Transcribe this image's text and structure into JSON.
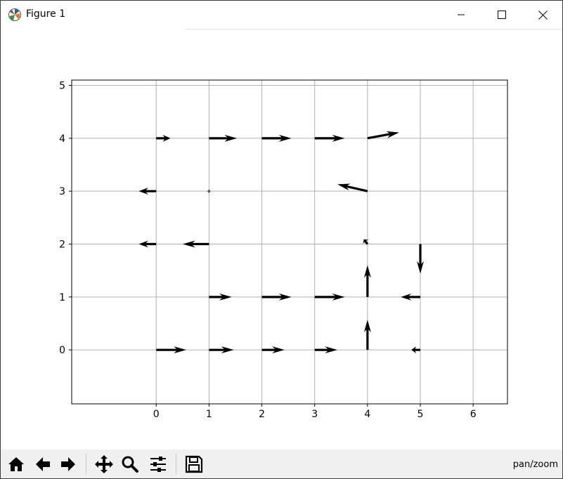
{
  "window": {
    "title": "Figure 1"
  },
  "icons": {
    "app": "matplotlib-logo-icon",
    "minimize": "minimize-icon",
    "maximize": "maximize-icon",
    "close": "close-icon"
  },
  "toolbar": {
    "buttons": [
      "home-icon",
      "back-icon",
      "forward-icon",
      "pan-icon",
      "zoom-icon",
      "configure-subplots-icon",
      "save-icon"
    ],
    "status": "pan/zoom"
  },
  "chart_data": {
    "type": "quiver",
    "title": "",
    "xlabel": "",
    "ylabel": "",
    "xlim": [
      -1.6,
      6.65
    ],
    "ylim": [
      -1.02,
      5.1
    ],
    "xticks": [
      0,
      1,
      2,
      3,
      4,
      5,
      6
    ],
    "yticks": [
      0,
      1,
      2,
      3,
      4,
      5
    ],
    "grid": true,
    "arrow_color": "#000000",
    "arrows": [
      {
        "x": 0,
        "y": 4,
        "u": 0.27,
        "v": 0
      },
      {
        "x": 1,
        "y": 4,
        "u": 0.53,
        "v": 0
      },
      {
        "x": 2,
        "y": 4,
        "u": 0.56,
        "v": 0
      },
      {
        "x": 3,
        "y": 4,
        "u": 0.57,
        "v": 0
      },
      {
        "x": 4,
        "y": 4,
        "u": 0.6,
        "v": 0.11
      },
      {
        "x": 0,
        "y": 3,
        "u": -0.33,
        "v": 0
      },
      {
        "x": 1,
        "y": 3,
        "u": 0,
        "v": 0
      },
      {
        "x": 4,
        "y": 3,
        "u": -0.57,
        "v": 0.13
      },
      {
        "x": 0,
        "y": 2,
        "u": -0.33,
        "v": 0
      },
      {
        "x": 1,
        "y": 2,
        "u": -0.5,
        "v": 0
      },
      {
        "x": 4,
        "y": 2,
        "u": -0.07,
        "v": 0.09
      },
      {
        "x": 5,
        "y": 2,
        "u": 0,
        "v": -0.56
      },
      {
        "x": 1,
        "y": 1,
        "u": 0.43,
        "v": 0
      },
      {
        "x": 2,
        "y": 1,
        "u": 0.56,
        "v": 0
      },
      {
        "x": 3,
        "y": 1,
        "u": 0.57,
        "v": 0
      },
      {
        "x": 4,
        "y": 1,
        "u": 0,
        "v": 0.6
      },
      {
        "x": 5,
        "y": 1,
        "u": -0.37,
        "v": 0
      },
      {
        "x": 0,
        "y": 0,
        "u": 0.57,
        "v": 0
      },
      {
        "x": 1,
        "y": 0,
        "u": 0.47,
        "v": 0
      },
      {
        "x": 2,
        "y": 0,
        "u": 0.43,
        "v": 0
      },
      {
        "x": 3,
        "y": 0,
        "u": 0.43,
        "v": 0
      },
      {
        "x": 4,
        "y": 0,
        "u": 0,
        "v": 0.57
      },
      {
        "x": 5,
        "y": 0,
        "u": -0.17,
        "v": 0
      }
    ]
  }
}
